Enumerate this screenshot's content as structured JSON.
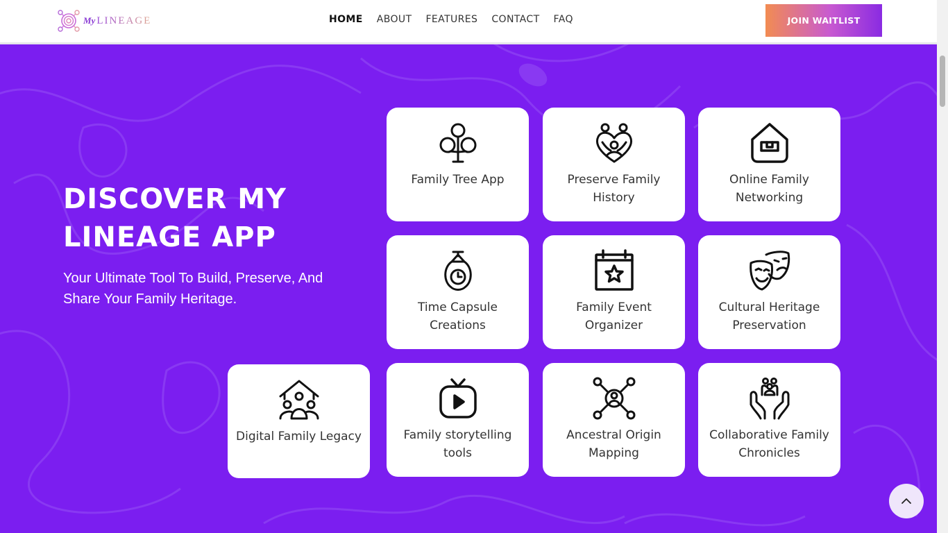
{
  "header": {
    "logo": {
      "my": "My",
      "lineage": "LINEAGE",
      "icon": "fingerprint-circles-logo"
    },
    "nav": [
      {
        "label": "HOME",
        "active": true
      },
      {
        "label": "ABOUT",
        "active": false
      },
      {
        "label": "FEATURES",
        "active": false
      },
      {
        "label": "CONTACT",
        "active": false
      },
      {
        "label": "FAQ",
        "active": false
      }
    ],
    "cta_label": "JOIN WAITLIST"
  },
  "hero": {
    "title": "DISCOVER MY LINEAGE APP",
    "subtitle": "Your Ultimate Tool To Build, Preserve, And Share Your Family Heritage."
  },
  "features": [
    {
      "label": "Family Tree App",
      "icon": "tree-icon"
    },
    {
      "label": "Preserve Family History",
      "icon": "family-heart-icon"
    },
    {
      "label": "Online Family Networking",
      "icon": "home-network-icon"
    },
    {
      "label": "Time Capsule Creations",
      "icon": "time-capsule-icon"
    },
    {
      "label": "Family Event Organizer",
      "icon": "calendar-star-icon"
    },
    {
      "label": "Cultural Heritage Preservation",
      "icon": "theater-masks-icon"
    },
    {
      "label": "Digital Family Legacy",
      "icon": "family-house-icon"
    },
    {
      "label": "Family storytelling tools",
      "icon": "tv-play-icon"
    },
    {
      "label": "Ancestral Origin Mapping",
      "icon": "network-user-icon"
    },
    {
      "label": "Collaborative Family Chronicles",
      "icon": "hands-family-icon"
    }
  ],
  "scroll_top_icon": "chevron-up-icon",
  "colors": {
    "accent": "#7b1ef0",
    "card": "#ffffff",
    "cta_start": "#f28c52",
    "cta_end": "#8a2be2"
  }
}
